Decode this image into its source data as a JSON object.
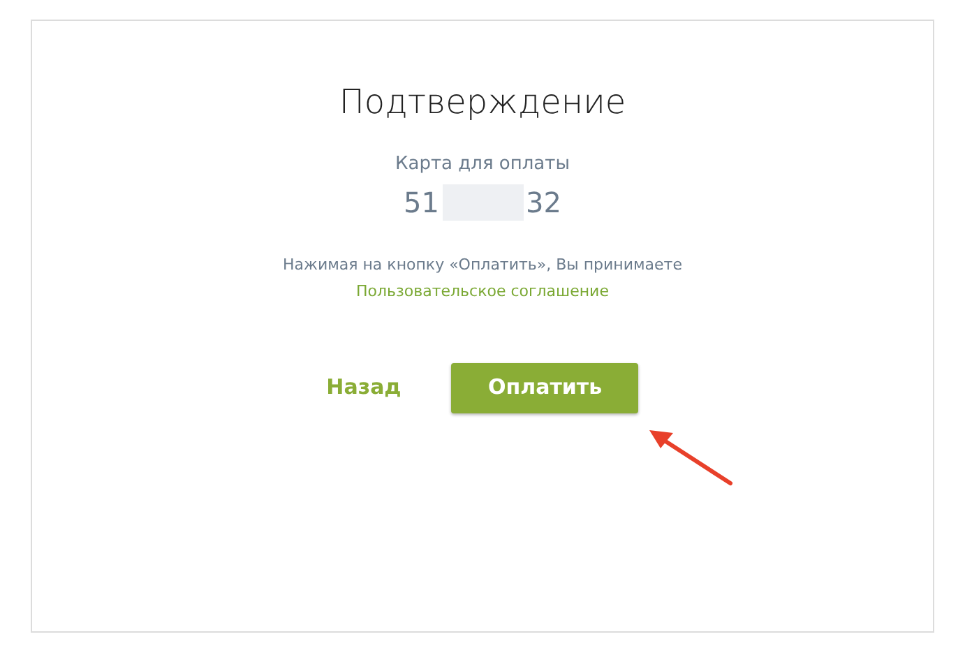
{
  "title": "Подтверждение",
  "card": {
    "label": "Карта для оплаты",
    "number_start": "51",
    "number_end": "32"
  },
  "agreement": {
    "text": "Нажимая на кнопку «Оплатить», Вы принимаете",
    "link": "Пользовательское соглашение"
  },
  "buttons": {
    "back": "Назад",
    "pay": "Оплатить"
  }
}
